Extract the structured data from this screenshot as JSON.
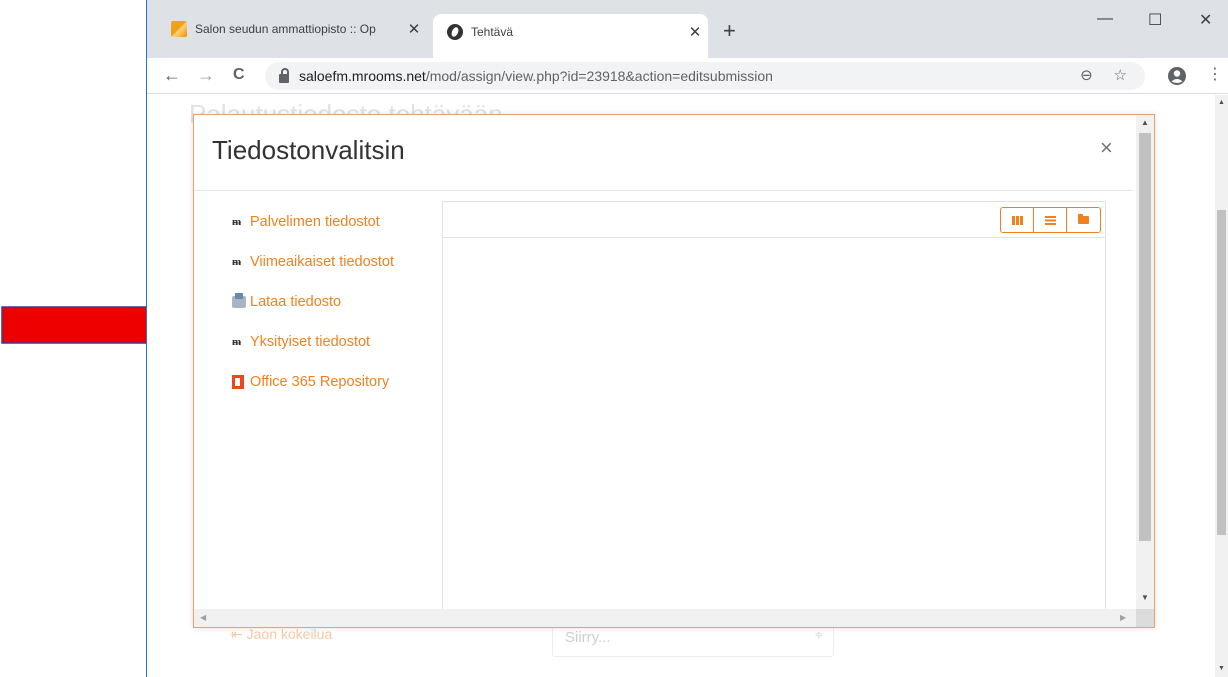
{
  "browser": {
    "tabs": [
      {
        "title": "Salon seudun ammattiopisto :: Op",
        "close": "✕",
        "active": false,
        "favicon": "salon-favicon"
      },
      {
        "title": "Tehtävä",
        "close": "✕",
        "active": true,
        "favicon": "tehtava-favicon"
      }
    ],
    "new_tab": "+",
    "window_controls": {
      "minimize": "—",
      "maximize": "☐",
      "close": "✕"
    },
    "nav": {
      "back": "←",
      "forward": "→",
      "reload": "C"
    },
    "url": {
      "host": "saloefm.mrooms.net",
      "path": "/mod/assign/view.php?id=23918&action=editsubmission"
    },
    "omnibox_icons": {
      "zoom": "⊖",
      "bookmark": "☆"
    },
    "menu": "⋮"
  },
  "page": {
    "ghost_title": "Palautustiedosto tehtävään",
    "ghost_link": "⇤ Jaon kokeilua",
    "jump_select": {
      "value": "Siirry...",
      "arrows": "≑"
    }
  },
  "dialog": {
    "title": "Tiedostonvalitsin",
    "close": "×",
    "repositories": [
      {
        "label": "Palvelimen tiedostot",
        "icon": "moodle-icon"
      },
      {
        "label": "Viimeaikaiset tiedostot",
        "icon": "moodle-icon"
      },
      {
        "label": "Lataa tiedosto",
        "icon": "upload-icon"
      },
      {
        "label": "Yksityiset tiedostot",
        "icon": "moodle-icon"
      },
      {
        "label": "Office 365 Repository",
        "icon": "office365-icon"
      }
    ],
    "view_buttons": [
      "icons-view",
      "list-view",
      "tree-view"
    ]
  },
  "colors": {
    "accent": "#f0821e",
    "annotation_arrow": "#ee0000",
    "dialog_border": "#f0a060"
  }
}
